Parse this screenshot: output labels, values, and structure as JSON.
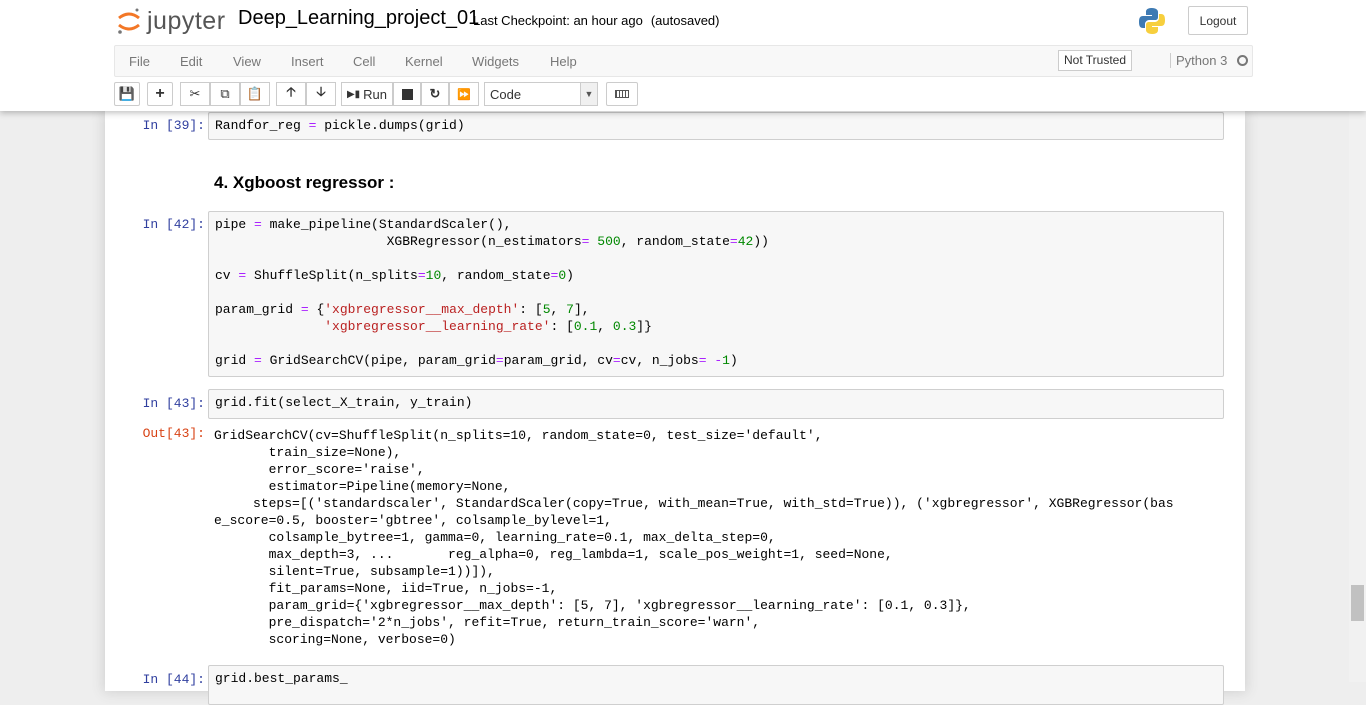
{
  "header": {
    "logo_text": "jupyter",
    "notebook_name": "Deep_Learning_project_01",
    "checkpoint": "Last Checkpoint: an hour ago",
    "autosaved": "(autosaved)",
    "logout": "Logout"
  },
  "menu": {
    "items": [
      "File",
      "Edit",
      "View",
      "Insert",
      "Cell",
      "Kernel",
      "Widgets",
      "Help"
    ],
    "trusted": "Not Trusted",
    "kernel": "Python 3"
  },
  "toolbar": {
    "run": "Run",
    "cell_type": "Code"
  },
  "cells": [
    {
      "prompt": "In [39]:",
      "lines": [
        [
          [
            "Randfor_reg ",
            ""
          ],
          [
            "=",
            "o"
          ],
          [
            " pickle.dumps(grid)",
            ""
          ]
        ]
      ]
    },
    {
      "heading": "4. Xgboost regressor :"
    },
    {
      "prompt": "In [42]:",
      "lines": [
        [
          [
            "pipe ",
            ""
          ],
          [
            "=",
            "o"
          ],
          [
            " make_pipeline(StandardScaler(),",
            ""
          ]
        ],
        [
          [
            "                      XGBRegressor(n_estimators",
            ""
          ],
          [
            "=",
            "o"
          ],
          [
            " ",
            ""
          ],
          [
            "500",
            "n"
          ],
          [
            ", random_state",
            ""
          ],
          [
            "=",
            "o"
          ],
          [
            "42",
            "n"
          ],
          [
            "))",
            ""
          ]
        ],
        [],
        [
          [
            "cv ",
            ""
          ],
          [
            "=",
            "o"
          ],
          [
            " ShuffleSplit(n_splits",
            ""
          ],
          [
            "=",
            "o"
          ],
          [
            "10",
            "n"
          ],
          [
            ", random_state",
            ""
          ],
          [
            "=",
            "o"
          ],
          [
            "0",
            "n"
          ],
          [
            ")",
            ""
          ]
        ],
        [],
        [
          [
            "param_grid ",
            ""
          ],
          [
            "=",
            "o"
          ],
          [
            " {",
            ""
          ],
          [
            "'xgbregressor__max_depth'",
            "s"
          ],
          [
            ": [",
            ""
          ],
          [
            "5",
            "n"
          ],
          [
            ", ",
            ""
          ],
          [
            "7",
            "n"
          ],
          [
            "],",
            ""
          ]
        ],
        [
          [
            "              ",
            ""
          ],
          [
            "'xgbregressor__learning_rate'",
            "s"
          ],
          [
            ": [",
            ""
          ],
          [
            "0.1",
            "n"
          ],
          [
            ", ",
            ""
          ],
          [
            "0.3",
            "n"
          ],
          [
            "]}",
            ""
          ]
        ],
        [],
        [
          [
            "grid ",
            ""
          ],
          [
            "=",
            "o"
          ],
          [
            " GridSearchCV(pipe, param_grid",
            ""
          ],
          [
            "=",
            "o"
          ],
          [
            "param_grid, cv",
            ""
          ],
          [
            "=",
            "o"
          ],
          [
            "cv, n_jobs",
            ""
          ],
          [
            "=",
            "o"
          ],
          [
            " ",
            ""
          ],
          [
            "-",
            "o"
          ],
          [
            "1",
            "n"
          ],
          [
            ")",
            ""
          ]
        ]
      ]
    },
    {
      "prompt": "In [43]:",
      "lines": [
        [
          [
            "grid.fit(select_X_train, y_train)",
            ""
          ]
        ]
      ]
    },
    {
      "prompt": "Out[43]:",
      "output": "GridSearchCV(cv=ShuffleSplit(n_splits=10, random_state=0, test_size='default',\n       train_size=None),\n       error_score='raise',\n       estimator=Pipeline(memory=None,\n     steps=[('standardscaler', StandardScaler(copy=True, with_mean=True, with_std=True)), ('xgbregressor', XGBRegressor(bas\ne_score=0.5, booster='gbtree', colsample_bylevel=1,\n       colsample_bytree=1, gamma=0, learning_rate=0.1, max_delta_step=0,\n       max_depth=3, ...       reg_alpha=0, reg_lambda=1, scale_pos_weight=1, seed=None,\n       silent=True, subsample=1))]),\n       fit_params=None, iid=True, n_jobs=-1,\n       param_grid={'xgbregressor__max_depth': [5, 7], 'xgbregressor__learning_rate': [0.1, 0.3]},\n       pre_dispatch='2*n_jobs', refit=True, return_train_score='warn',\n       scoring=None, verbose=0)"
    },
    {
      "prompt": "In [44]:",
      "lines": [
        [
          [
            "grid.best_params_",
            ""
          ]
        ]
      ]
    }
  ]
}
